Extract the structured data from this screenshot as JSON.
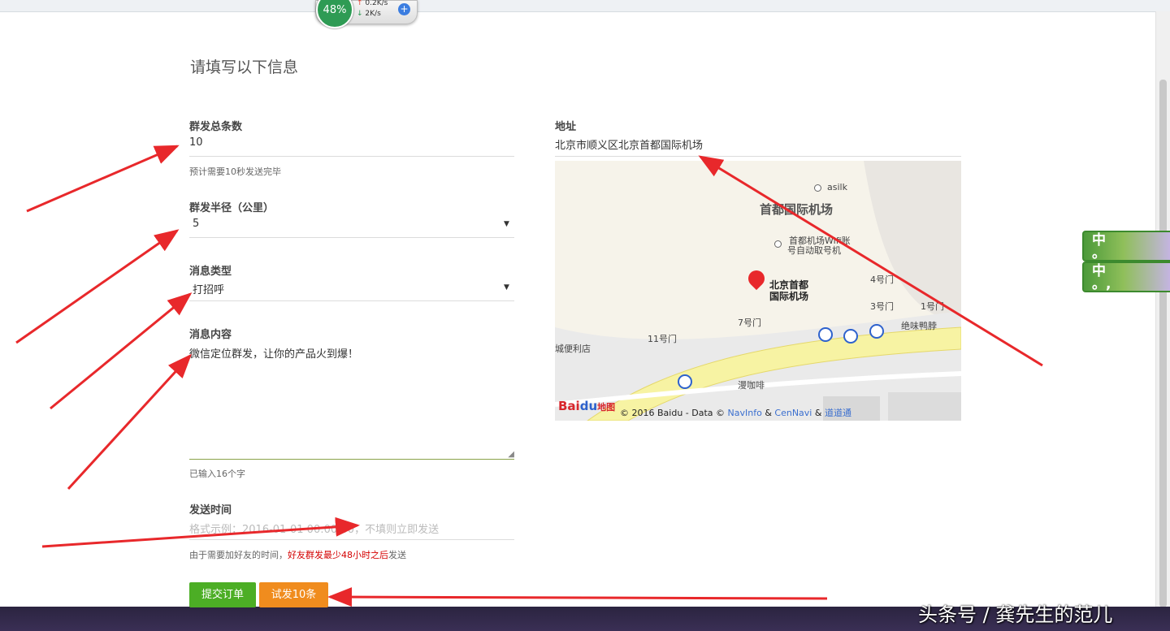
{
  "network": {
    "percent": "48%",
    "up": "0.2K/s",
    "down": "2K/s",
    "plus": "+"
  },
  "form": {
    "title": "请填写以下信息",
    "total": {
      "label": "群发总条数",
      "value": "10",
      "hint": "预计需要10秒发送完毕"
    },
    "radius": {
      "label": "群发半径（公里）",
      "value": "5"
    },
    "type": {
      "label": "消息类型",
      "value": "打招呼"
    },
    "content": {
      "label": "消息内容",
      "value": "微信定位群发，让你的产品火到爆！",
      "hint": "已输入16个字"
    },
    "time": {
      "label": "发送时间",
      "placeholder": "格式示例：2016-01-01 00:00:00，不填则立即发送",
      "hint_prefix": "由于需要加好友的时间，",
      "hint_red": "好友群发最少48小时之后",
      "hint_suffix": "发送"
    },
    "address": {
      "label": "地址",
      "value": "北京市顺义区北京首都国际机场"
    }
  },
  "buttons": {
    "submit": "提交订单",
    "trial": "试发10条"
  },
  "map": {
    "labels": {
      "asilk": "asilk",
      "airport_big": "首都国际机场",
      "wifi_1": "首都机场Wifi账",
      "wifi_2": "号自动取号机",
      "main_1": "北京首都",
      "main_2": "国际机场",
      "gate4": "4号门",
      "gate3": "3号门",
      "gate1": "1号门",
      "gate7": "7号门",
      "gate11": "11号门",
      "store": "城便利店",
      "duck": "绝味鸭脖",
      "coffee": "漫咖啡"
    },
    "copyright_prefix": "© 2016 Baidu - Data ©",
    "navinfo": "NavInfo",
    "amp1": "&",
    "cennavi": "CenNavi",
    "amp2": "&",
    "daodao": "道道通",
    "logo_bai": "Bai",
    "logo_du": "du",
    "logo_map": "地图"
  },
  "ime": {
    "char1": "中",
    "sub1": "。",
    "char2": "中",
    "sub2": "。,"
  },
  "watermark": "头条号 / 龚先生的范儿",
  "colors": {
    "submit": "#4cae25",
    "trial": "#f08c1e",
    "arrow": "#e8282b",
    "hint_red": "#d40000"
  }
}
